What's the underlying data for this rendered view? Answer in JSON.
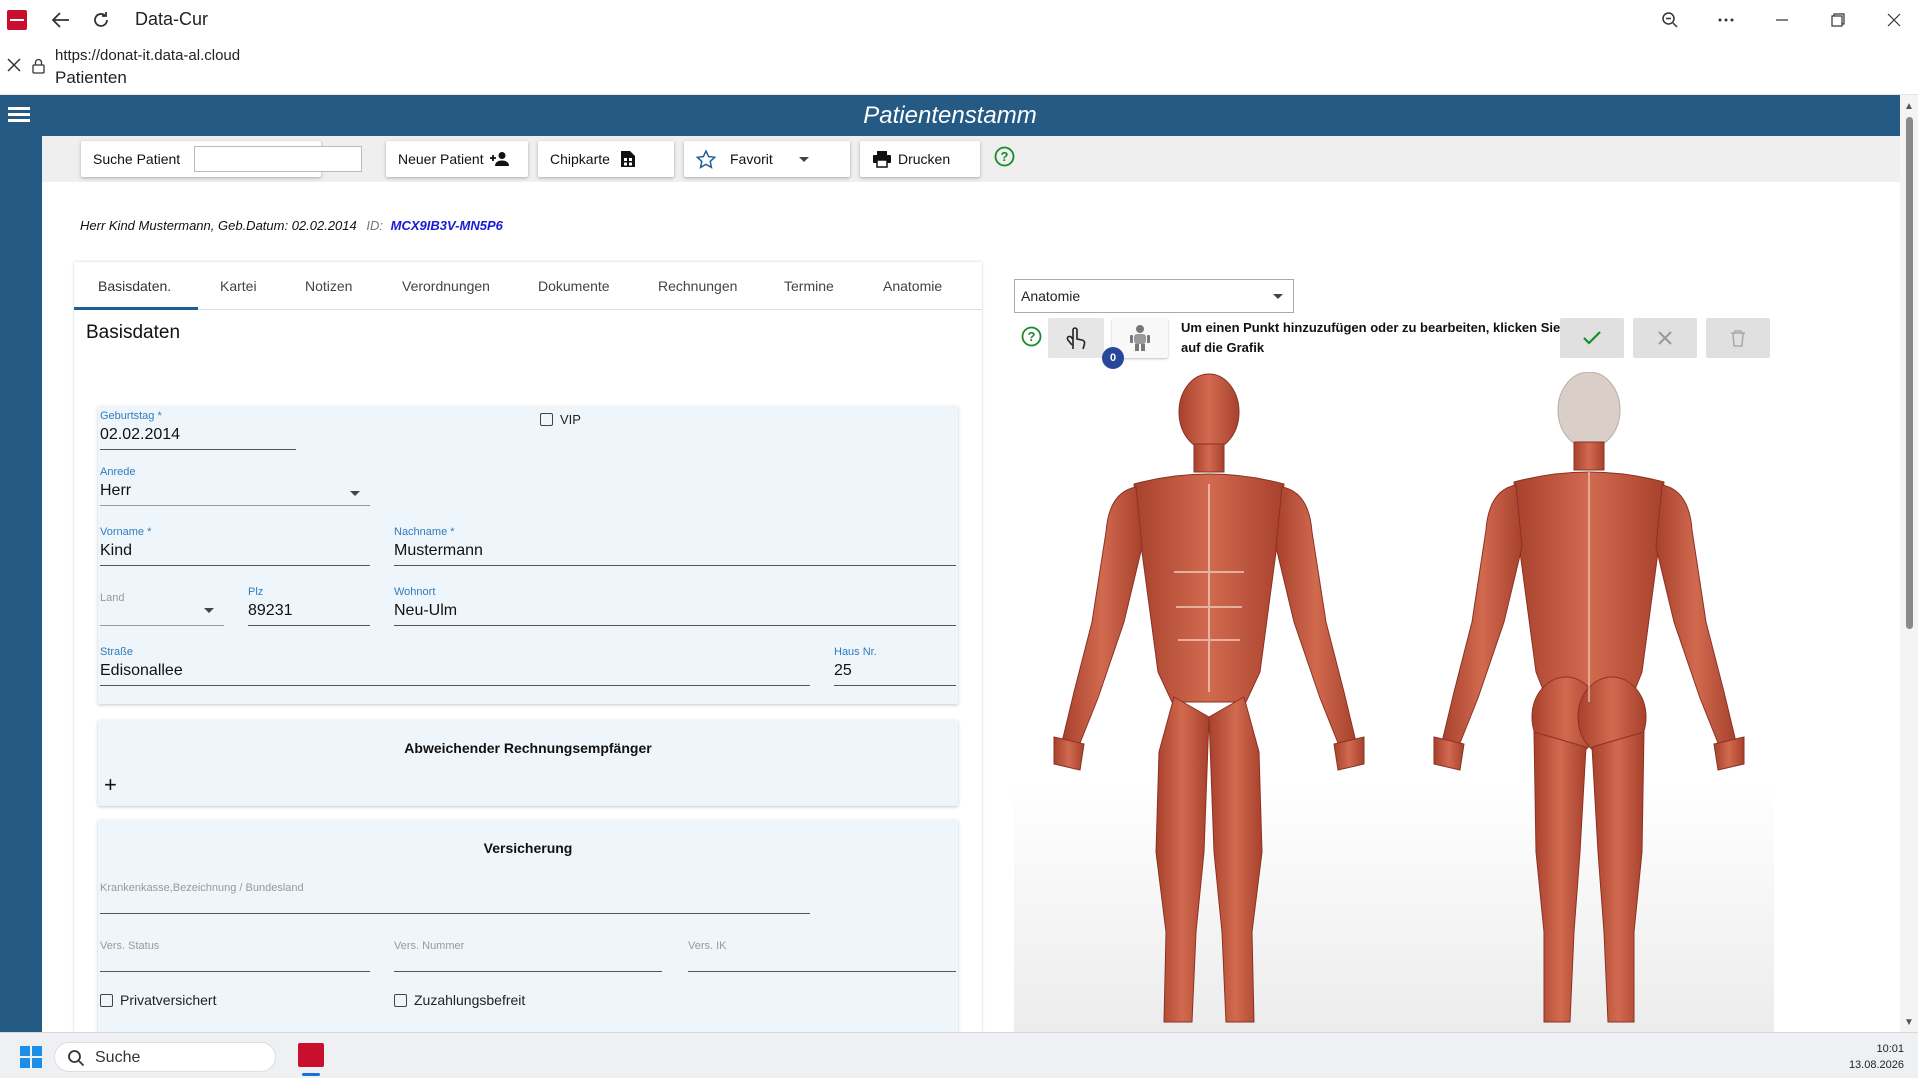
{
  "browser": {
    "tab_title": "Data-Cur",
    "url": "https://donat-it.data-al.cloud",
    "page_title": "Patienten"
  },
  "appbar": {
    "title": "Patientenstamm"
  },
  "toolbar": {
    "search_label": "Suche Patient",
    "search_value": "",
    "new_patient_label": "Neuer Patient",
    "chipcard_label": "Chipkarte",
    "favorite_label": "Favorit",
    "print_label": "Drucken"
  },
  "patient": {
    "summary": "Herr Kind Mustermann, Geb.Datum: 02.02.2014",
    "id_label": "ID:",
    "id_value": "MCX9IB3V-MN5P6"
  },
  "tabs": [
    "Basisdaten.",
    "Kartei",
    "Notizen",
    "Verordnungen",
    "Dokumente",
    "Rechnungen",
    "Termine",
    "Anatomie"
  ],
  "basisdaten": {
    "title": "Basisdaten",
    "geburtstag_label": "Geburtstag *",
    "geburtstag_value": "02.02.2014",
    "vip_label": "VIP",
    "anrede_label": "Anrede",
    "anrede_value": "Herr",
    "vorname_label": "Vorname *",
    "vorname_value": "Kind",
    "nachname_label": "Nachname *",
    "nachname_value": "Mustermann",
    "land_label": "Land",
    "plz_label": "Plz",
    "plz_value": "89231",
    "wohnort_label": "Wohnort",
    "wohnort_value": "Neu-Ulm",
    "strasse_label": "Straße",
    "strasse_value": "Edisonallee",
    "hausnr_label": "Haus Nr.",
    "hausnr_value": "25"
  },
  "rechnung": {
    "title": "Abweichender Rechnungsempfänger",
    "add_symbol": "+"
  },
  "versicherung": {
    "title": "Versicherung",
    "kasse_placeholder": "Krankenkasse,Bezeichnung / Bundesland",
    "status_placeholder": "Vers. Status",
    "nummer_placeholder": "Vers. Nummer",
    "ik_placeholder": "Vers. IK",
    "privat_label": "Privatversichert",
    "zuzahlung_label": "Zuzahlungsbefreit"
  },
  "anatomie": {
    "select_value": "Anatomie",
    "badge_count": "0",
    "hint": "Um einen Punkt hinzuzufügen oder zu bearbeiten, klicken Sie auf die Grafik"
  },
  "taskbar": {
    "search_label": "Suche",
    "time": "10:01",
    "date": "13.08.2026"
  },
  "colors": {
    "accent": "#245a84",
    "link": "#1a1ad6",
    "field_label": "#2f7bc0",
    "card_bg": "#eef6fb",
    "muscle": "#c0523a"
  }
}
